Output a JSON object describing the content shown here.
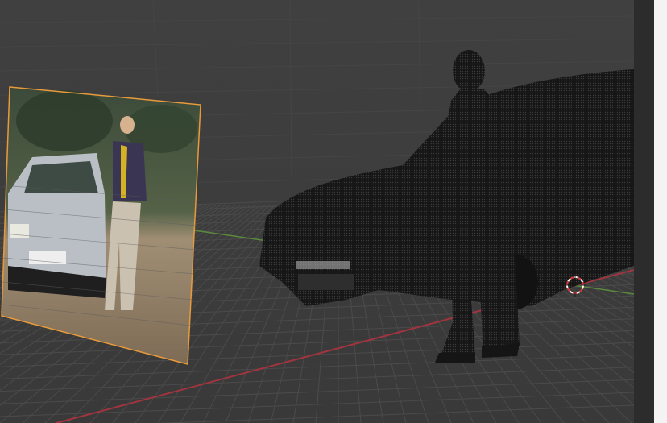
{
  "app": "3D viewport",
  "colors": {
    "background": "#3d3d3d",
    "grid": "#4a4a4a",
    "x_axis": "#a0343f",
    "y_axis": "#5b8a3c",
    "selection_outline": "#e89a3b",
    "mesh": "#1c1c1c",
    "cursor_red": "#d63a3a",
    "cursor_white": "#ffffff"
  },
  "objects": [
    {
      "name": "reference-image-plane",
      "selected": true,
      "type": "image-empty"
    },
    {
      "name": "car-pointcloud-mesh",
      "selected": false,
      "type": "mesh"
    },
    {
      "name": "man-pointcloud-mesh",
      "selected": false,
      "type": "mesh"
    }
  ],
  "gizmos": [
    "3d-cursor-icon"
  ]
}
